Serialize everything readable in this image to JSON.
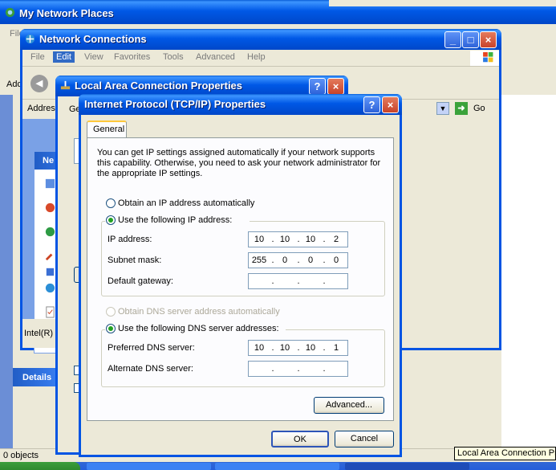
{
  "my_network_places": {
    "title": "My Network Places",
    "menu_first": "File",
    "address_label": "Add"
  },
  "network_connections": {
    "title": "Network Connections",
    "menu": [
      "File",
      "Edit",
      "View",
      "Favorites",
      "Tools",
      "Advanced",
      "Help"
    ],
    "address_label": "Address",
    "go_label": "Go",
    "task_header": "Ne",
    "adapter_text": "Intel(R)",
    "details_label": "Details",
    "status_count": "0 objects"
  },
  "lan_properties": {
    "title": "Local Area Connection Properties",
    "tab_fragment": "Ge",
    "status_tooltip": "Local Area Connection Pro"
  },
  "tcpip": {
    "title": "Internet Protocol (TCP/IP) Properties",
    "tab": "General",
    "description": "You can get IP settings assigned automatically if your network supports this capability. Otherwise, you need to ask your network administrator for the appropriate IP settings.",
    "ip_auto_label": "Obtain an IP address automatically",
    "ip_manual_label": "Use the following IP address:",
    "ip_label": "IP address:",
    "ip_address": [
      "10",
      "10",
      "10",
      "2"
    ],
    "subnet_label": "Subnet mask:",
    "subnet_mask": [
      "255",
      "0",
      "0",
      "0"
    ],
    "gateway_label": "Default gateway:",
    "gateway": [
      "",
      "",
      "",
      ""
    ],
    "dns_auto_label": "Obtain DNS server address automatically",
    "dns_manual_label": "Use the following DNS server addresses:",
    "pref_dns_label": "Preferred DNS server:",
    "pref_dns": [
      "10",
      "10",
      "10",
      "1"
    ],
    "alt_dns_label": "Alternate DNS server:",
    "alt_dns": [
      "",
      "",
      "",
      ""
    ],
    "advanced_label": "Advanced...",
    "ok_label": "OK",
    "cancel_label": "Cancel",
    "selected_ip_mode": "manual",
    "selected_dns_mode": "manual"
  },
  "colors": {
    "title_blue": "#0054e3",
    "dialog_bg": "#ece9d8",
    "close_red": "#c8432a"
  }
}
